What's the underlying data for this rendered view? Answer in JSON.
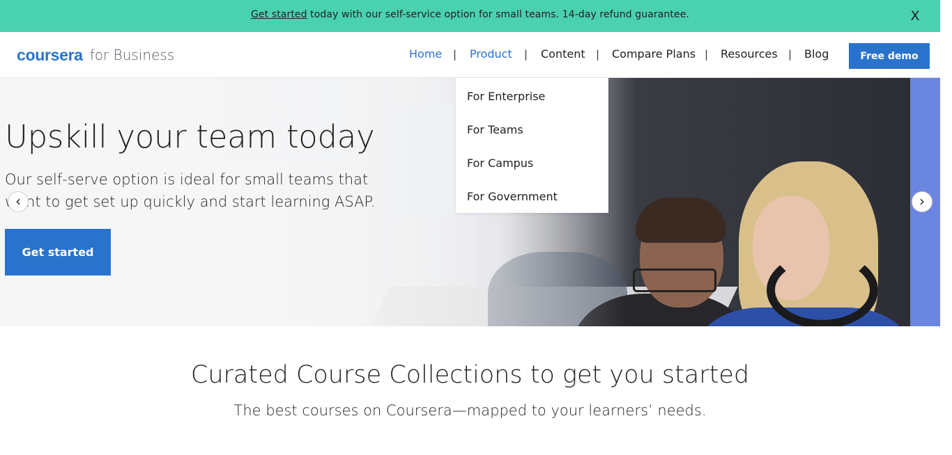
{
  "promo": {
    "link_text": "Get started",
    "text": " today with our self-service option for small teams. 14-day refund guarantee.",
    "close_label": "X",
    "background": "#4ad1b0"
  },
  "header": {
    "logo_word": "coursera",
    "logo_suffix": "for Business",
    "nav": [
      {
        "label": "Home"
      },
      {
        "label": "Product"
      },
      {
        "label": "Content"
      },
      {
        "label": "Compare Plans"
      },
      {
        "label": "Resources"
      },
      {
        "label": "Blog"
      }
    ],
    "separator": "|",
    "cta_label": "Free demo",
    "accent": "#2a73cc"
  },
  "dropdown": {
    "items": [
      {
        "label": "For Enterprise"
      },
      {
        "label": "For Teams"
      },
      {
        "label": "For Campus"
      },
      {
        "label": "For Government"
      }
    ]
  },
  "hero": {
    "title": "Upskill your team today",
    "subtitle": "Our self-serve option is ideal for small teams that want to get set up quickly and start learning ASAP.",
    "cta_label": "Get started",
    "prev_icon": "‹",
    "next_icon": "›"
  },
  "section": {
    "title": "Curated Course Collections to get you started",
    "subtitle": "The best courses on Coursera—mapped to your learners’ needs."
  }
}
